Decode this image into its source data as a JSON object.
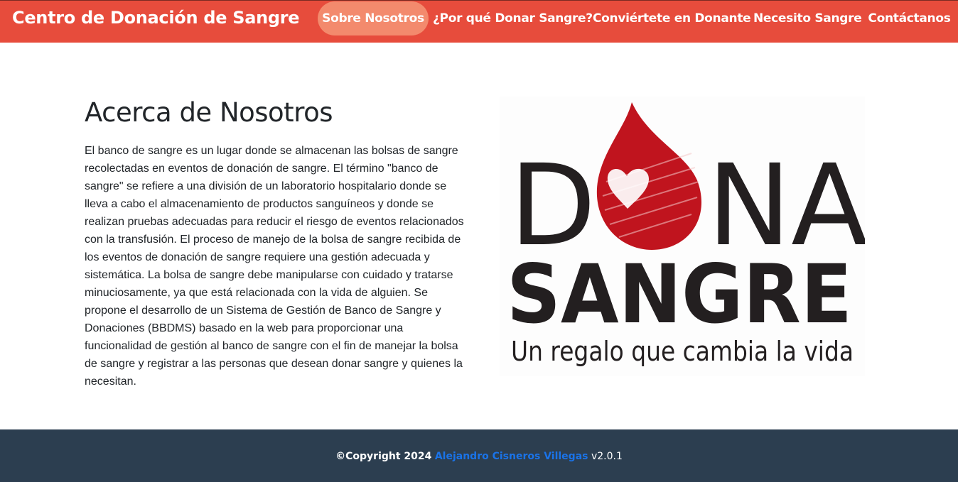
{
  "navbar": {
    "brand": "Centro de Donación de Sangre",
    "links": [
      {
        "label": "Sobre Nosotros",
        "active": true
      },
      {
        "label": "¿Por qué Donar Sangre?"
      },
      {
        "label": "Conviértete en Donante"
      },
      {
        "label": "Necesito Sangre"
      },
      {
        "label": "Contáctanos"
      }
    ]
  },
  "about": {
    "title": "Acerca de Nosotros",
    "body": "El banco de sangre es un lugar donde se almacenan las bolsas de sangre recolectadas en eventos de donación de sangre. El término \"banco de sangre\" se refiere a una división de un laboratorio hospitalario donde se lleva a cabo el almacenamiento de productos sanguíneos y donde se realizan pruebas adecuadas para reducir el riesgo de eventos relacionados con la transfusión. El proceso de manejo de la bolsa de sangre recibida de los eventos de donación de sangre requiere una gestión adecuada y sistemática. La bolsa de sangre debe manipularse con cuidado y tratarse minuciosamente, ya que está relacionada con la vida de alguien. Se propone el desarrollo de un Sistema de Gestión de Banco de Sangre y Donaciones (BBDMS) basado en la web para proporcionar una funcionalidad de gestión al banco de sangre con el fin de manejar la bolsa de sangre y registrar a las personas que desean donar sangre y quienes la necesitan."
  },
  "logo": {
    "word1_left": "D",
    "word1_right": "NA",
    "word2": "SANGRE",
    "tagline": "Un regalo que cambia la vida"
  },
  "footer": {
    "copyright": "©Copyright 2024",
    "author": "Alejandro Cisneros Villegas",
    "version": "v2.0.1"
  },
  "colors": {
    "navbar": "#e74c3c",
    "nav_active": "#f38a6d",
    "footer": "#2c3e50",
    "author_link": "#1a73e8",
    "drop": "#c0141e",
    "logo_text": "#231f20"
  }
}
